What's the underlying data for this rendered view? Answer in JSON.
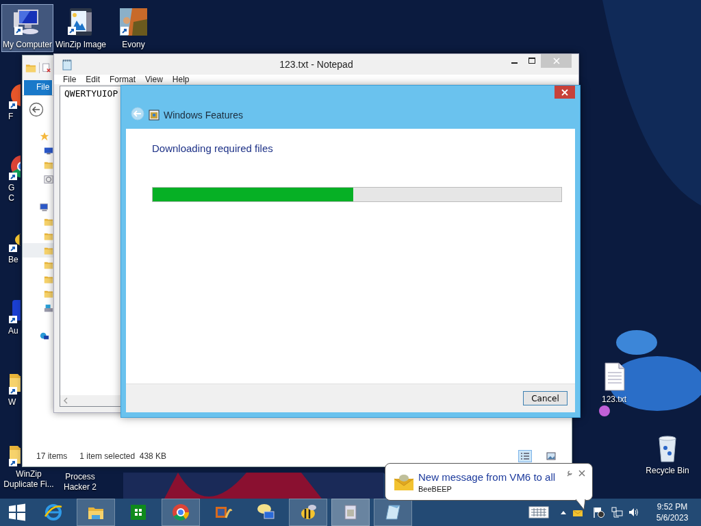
{
  "desktop_icons": [
    {
      "lines": [
        "My Computer"
      ],
      "selected": true
    },
    {
      "lines": [
        "WinZip Image"
      ],
      "selected": false
    },
    {
      "lines": [
        "Evony"
      ],
      "selected": false
    },
    {
      "lines": [
        "F"
      ],
      "selected": false
    },
    {
      "lines": [
        "G",
        "C"
      ],
      "selected": false
    },
    {
      "lines": [
        "Be"
      ],
      "selected": false
    },
    {
      "lines": [
        "Au"
      ],
      "selected": false
    },
    {
      "lines": [
        "W"
      ],
      "selected": false
    },
    {
      "lines": [
        "WinZip",
        "Duplicate Fi..."
      ],
      "selected": false
    },
    {
      "lines": [
        "Process",
        "Hacker 2"
      ],
      "selected": false
    },
    {
      "lines": [
        "123.txt"
      ],
      "selected": false
    },
    {
      "lines": [
        "Recycle Bin"
      ],
      "selected": false
    }
  ],
  "explorer": {
    "ribbon_tab": "File",
    "status": {
      "item_count": "17 items",
      "selection": "1 item selected  438 KB"
    },
    "views": [
      {
        "selected": true
      },
      {
        "selected": false
      }
    ]
  },
  "notepad": {
    "title": "123.txt - Notepad",
    "menu": [
      "File",
      "Edit",
      "Format",
      "View",
      "Help"
    ],
    "text": "QWERTYUIOP"
  },
  "dialog": {
    "title": "Windows Features",
    "message": "Downloading required files",
    "progress": {
      "level": 0.49
    },
    "buttons": [
      "Cancel"
    ]
  },
  "notification": {
    "title": "New message from VM6 to all",
    "app": "BeeBEEP"
  },
  "taskbar": {
    "apps": [
      {
        "running": false,
        "selected": false
      },
      {
        "running": true,
        "selected": false
      },
      {
        "running": false,
        "selected": false
      },
      {
        "running": true,
        "selected": false
      },
      {
        "running": false,
        "selected": false
      },
      {
        "running": false,
        "selected": false
      },
      {
        "running": true,
        "selected": false
      },
      {
        "running": true,
        "selected": true
      },
      {
        "running": true,
        "selected": false
      }
    ],
    "clock": {
      "time": "9:52 PM",
      "date": "5/6/2023"
    }
  }
}
